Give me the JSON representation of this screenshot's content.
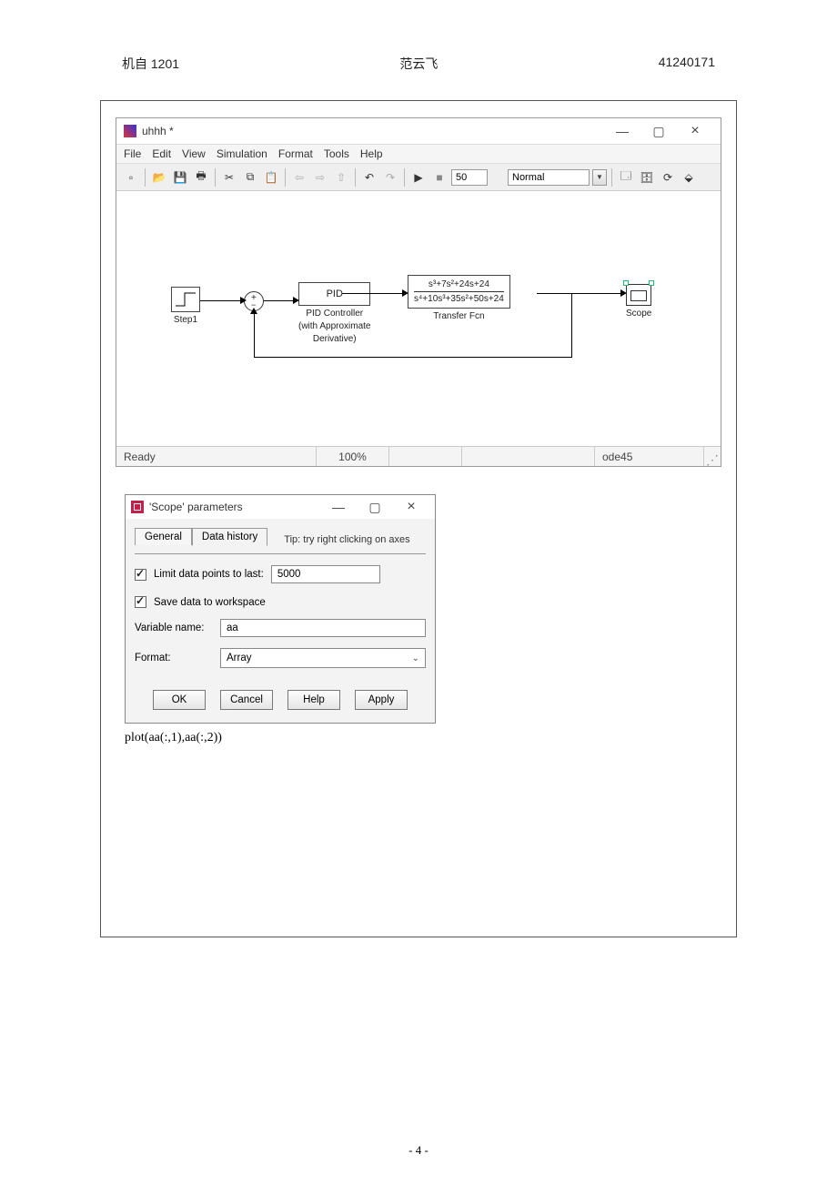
{
  "header": {
    "left": "机自 1201",
    "center": "范云飞",
    "right": "41240171"
  },
  "simwin": {
    "title": "uhhh *",
    "menu": [
      "File",
      "Edit",
      "View",
      "Simulation",
      "Format",
      "Tools",
      "Help"
    ],
    "toolbar": {
      "stop_time": "50",
      "mode": "Normal"
    },
    "blocks": {
      "step_label": "Step1",
      "pid_box": "PID",
      "pid_label_l1": "PID Controller",
      "pid_label_l2": "(with Approximate",
      "pid_label_l3": "Derivative)",
      "tf_num": "s³+7s²+24s+24",
      "tf_den": "s⁴+10s³+35s²+50s+24",
      "tf_label": "Transfer Fcn",
      "scope_label": "Scope"
    },
    "status": {
      "ready": "Ready",
      "zoom": "100%",
      "solver": "ode45"
    }
  },
  "dialog": {
    "title": "'Scope' parameters",
    "tab_general": "General",
    "tab_data": "Data history",
    "tip": "Tip: try right clicking on axes",
    "limit_label": "Limit data points to last:",
    "limit_value": "5000",
    "save_label": "Save data to workspace",
    "varname_label": "Variable name:",
    "varname_value": "aa",
    "format_label": "Format:",
    "format_value": "Array",
    "buttons": {
      "ok": "OK",
      "cancel": "Cancel",
      "help": "Help",
      "apply": "Apply"
    }
  },
  "code_line": "plot(aa(:,1),aa(:,2))",
  "page_number": "- 4 -",
  "chart_data": {
    "type": "diagram",
    "description": "Simulink block diagram: Step1 -> Sum(+ -) -> PID Controller (with Approximate Derivative) -> Transfer Fcn (s^3+7s^2+24s+24)/(s^4+10s^3+35s^2+50s+24) -> Scope. Feedback from Transfer Fcn output back to Sum negative input."
  }
}
